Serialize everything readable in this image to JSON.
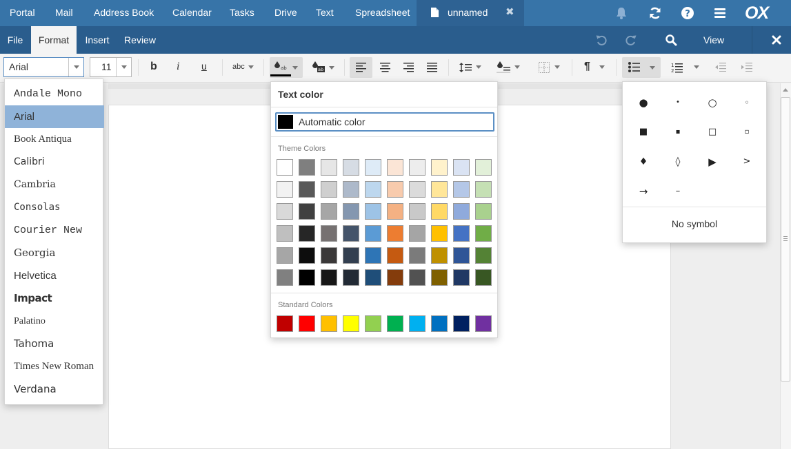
{
  "top_nav": {
    "apps": [
      "Portal",
      "Mail",
      "Address Book",
      "Calendar",
      "Tasks",
      "Drive",
      "Text",
      "Spreadsheet"
    ],
    "active_document": "unnamed",
    "close_glyph": "✖",
    "logo": "OX",
    "icons": [
      "bell-icon",
      "refresh-icon",
      "help-icon",
      "hamburger-menu-icon"
    ]
  },
  "menu_bar": {
    "tabs": [
      "File",
      "Format",
      "Insert",
      "Review"
    ],
    "active_tab": "Format",
    "view_label": "View",
    "icons": [
      "undo-icon",
      "redo-icon",
      "search-icon",
      "close-icon"
    ]
  },
  "toolbar": {
    "font_name": "Arial",
    "font_size": "11",
    "text_style_label": "abc",
    "paragraph_glyph": "¶",
    "icons": [
      "bold-icon",
      "italic-icon",
      "underline-icon",
      "text-color-icon",
      "highlight-color-icon",
      "align-left-icon",
      "align-center-icon",
      "align-right-icon",
      "justify-icon",
      "line-spacing-icon",
      "paragraph-fill-icon",
      "borders-icon",
      "bullet-list-icon",
      "numbered-list-icon",
      "decrease-indent-icon",
      "increase-indent-icon"
    ]
  },
  "font_list": {
    "selected": "Arial",
    "items": [
      "Andale Mono",
      "Arial",
      "Book Antiqua",
      "Calibri",
      "Cambria",
      "Consolas",
      "Courier New",
      "Georgia",
      "Helvetica",
      "Impact",
      "Palatino",
      "Tahoma",
      "Times New Roman",
      "Verdana"
    ]
  },
  "text_color_popup": {
    "title": "Text color",
    "automatic_label": "Automatic color",
    "automatic_color": "#000000",
    "theme_label": "Theme Colors",
    "theme_colors": [
      [
        "#ffffff",
        "#7f7f7f",
        "#e6e6e6",
        "#d6dce4",
        "#deebf7",
        "#fbe5d6",
        "#ededed",
        "#fff2cc",
        "#dae3f3",
        "#e2f0d9"
      ],
      [
        "#f2f2f2",
        "#595959",
        "#cfcfcf",
        "#adb9ca",
        "#bdd7ee",
        "#f8cbad",
        "#dbdbdb",
        "#ffe699",
        "#b4c7e7",
        "#c5e0b4"
      ],
      [
        "#d9d9d9",
        "#404040",
        "#a6a6a6",
        "#8497b0",
        "#9dc3e6",
        "#f4b183",
        "#c9c9c9",
        "#ffd966",
        "#8faadc",
        "#a9d18e"
      ],
      [
        "#bfbfbf",
        "#262626",
        "#767171",
        "#44546a",
        "#5b9bd5",
        "#ed7d31",
        "#a5a5a5",
        "#ffc000",
        "#4472c4",
        "#70ad47"
      ],
      [
        "#a6a6a6",
        "#0d0d0d",
        "#3a3838",
        "#333f50",
        "#2e75b6",
        "#c55a11",
        "#7b7b7b",
        "#bf9000",
        "#2f5597",
        "#548235"
      ],
      [
        "#808080",
        "#000000",
        "#171717",
        "#222a35",
        "#1f4e79",
        "#843c0c",
        "#525252",
        "#7f6000",
        "#203864",
        "#385723"
      ]
    ],
    "standard_label": "Standard Colors",
    "standard_colors": [
      "#c00000",
      "#ff0000",
      "#ffc000",
      "#ffff00",
      "#92d050",
      "#00b050",
      "#00b0f0",
      "#0070c0",
      "#002060",
      "#7030a0"
    ]
  },
  "bullet_popup": {
    "symbols": [
      "●",
      "•",
      "○",
      "◦",
      "■",
      "▪",
      "□",
      "▫",
      "♦",
      "◊",
      "▶",
      ">",
      "→",
      "–"
    ],
    "no_symbol_label": "No symbol"
  }
}
